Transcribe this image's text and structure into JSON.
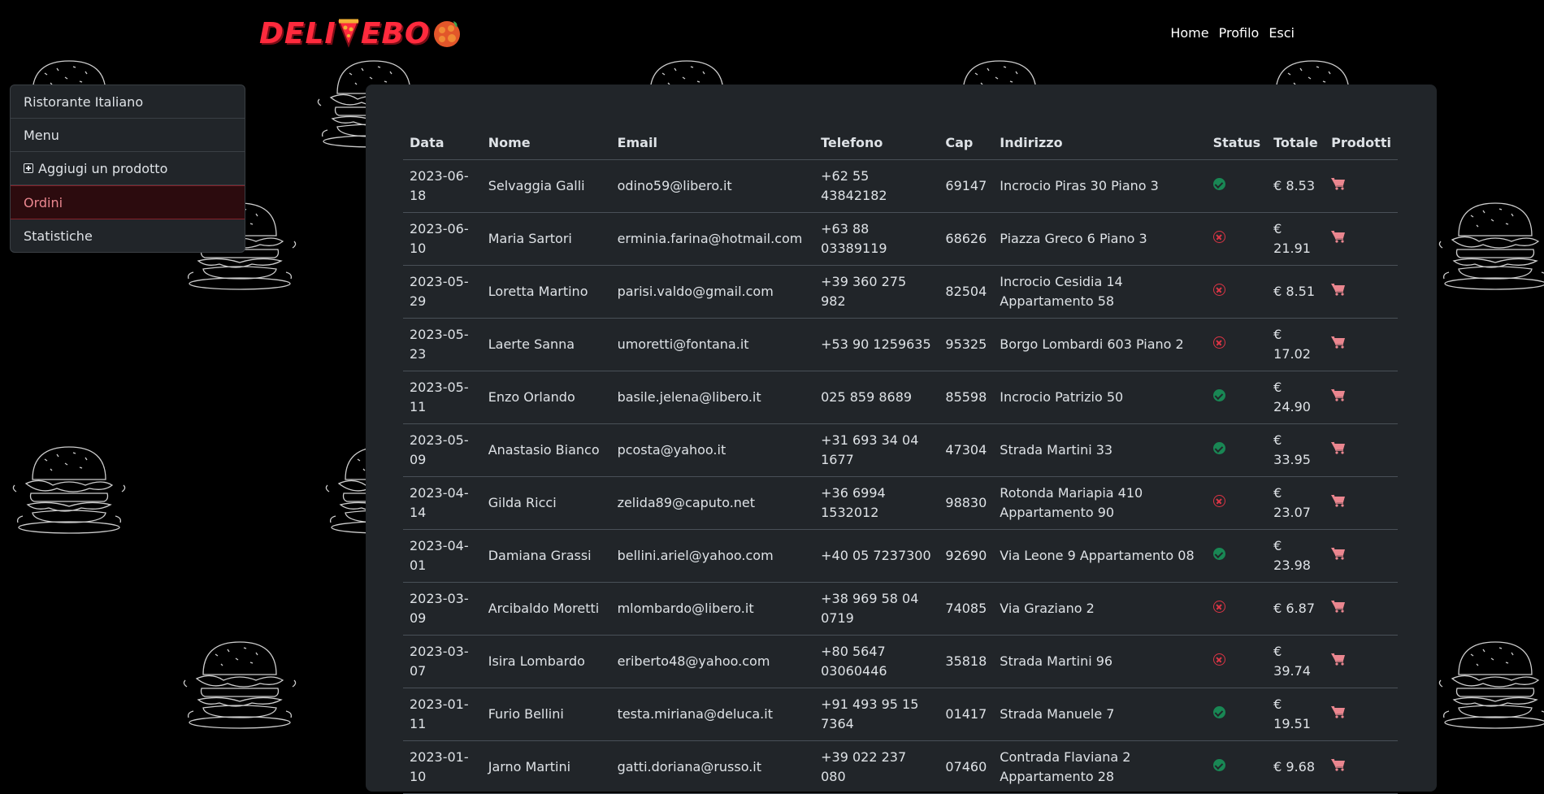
{
  "brand": {
    "logo_text": "DELIVEBOO",
    "logo_left": "DELI",
    "logo_right": "EBO"
  },
  "nav": {
    "home": "Home",
    "profile": "Profilo",
    "logout": "Esci"
  },
  "sidebar": {
    "items": [
      {
        "label": "Ristorante Italiano",
        "active": false
      },
      {
        "label": "Menu",
        "active": false
      },
      {
        "label": "Aggiugi un prodotto",
        "active": false,
        "icon": "plus-square-icon"
      },
      {
        "label": "Ordini",
        "active": true
      },
      {
        "label": "Statistiche",
        "active": false
      }
    ]
  },
  "orders": {
    "headers": {
      "date": "Data",
      "name": "Nome",
      "email": "Email",
      "phone": "Telefono",
      "cap": "Cap",
      "address": "Indirizzo",
      "status": "Status",
      "total": "Totale",
      "products": "Prodotti"
    },
    "rows": [
      {
        "date": "2023-06-18",
        "name": "Selvaggia Galli",
        "email": "odino59@libero.it",
        "phone": "+62 55 43842182",
        "cap": "69147",
        "address": "Incrocio Piras 30 Piano 3",
        "status": "ok",
        "total": "€ 8.53"
      },
      {
        "date": "2023-06-10",
        "name": "Maria Sartori",
        "email": "erminia.farina@hotmail.com",
        "phone": "+63 88 03389119",
        "cap": "68626",
        "address": "Piazza Greco 6 Piano 3",
        "status": "failed",
        "total": "€ 21.91"
      },
      {
        "date": "2023-05-29",
        "name": "Loretta Martino",
        "email": "parisi.valdo@gmail.com",
        "phone": "+39 360 275 982",
        "cap": "82504",
        "address": "Incrocio Cesidia 14 Appartamento 58",
        "status": "failed",
        "total": "€ 8.51"
      },
      {
        "date": "2023-05-23",
        "name": "Laerte Sanna",
        "email": "umoretti@fontana.it",
        "phone": "+53 90 1259635",
        "cap": "95325",
        "address": "Borgo Lombardi 603 Piano 2",
        "status": "failed",
        "total": "€ 17.02"
      },
      {
        "date": "2023-05-11",
        "name": "Enzo Orlando",
        "email": "basile.jelena@libero.it",
        "phone": "025 859 8689",
        "cap": "85598",
        "address": "Incrocio Patrizio 50",
        "status": "ok",
        "total": "€ 24.90"
      },
      {
        "date": "2023-05-09",
        "name": "Anastasio Bianco",
        "email": "pcosta@yahoo.it",
        "phone": "+31 693 34 04 1677",
        "cap": "47304",
        "address": "Strada Martini 33",
        "status": "ok",
        "total": "€ 33.95"
      },
      {
        "date": "2023-04-14",
        "name": "Gilda Ricci",
        "email": "zelida89@caputo.net",
        "phone": "+36 6994 1532012",
        "cap": "98830",
        "address": "Rotonda Mariapia 410 Appartamento 90",
        "status": "failed",
        "total": "€ 23.07"
      },
      {
        "date": "2023-04-01",
        "name": "Damiana Grassi",
        "email": "bellini.ariel@yahoo.com",
        "phone": "+40 05 7237300",
        "cap": "92690",
        "address": "Via Leone 9 Appartamento 08",
        "status": "ok",
        "total": "€ 23.98"
      },
      {
        "date": "2023-03-09",
        "name": "Arcibaldo Moretti",
        "email": "mlombardo@libero.it",
        "phone": "+38 969 58 04 0719",
        "cap": "74085",
        "address": "Via Graziano 2",
        "status": "failed",
        "total": "€ 6.87"
      },
      {
        "date": "2023-03-07",
        "name": "Isira Lombardo",
        "email": "eriberto48@yahoo.com",
        "phone": "+80 5647 03060446",
        "cap": "35818",
        "address": "Strada Martini 96",
        "status": "failed",
        "total": "€ 39.74"
      },
      {
        "date": "2023-01-11",
        "name": "Furio Bellini",
        "email": "testa.miriana@deluca.it",
        "phone": "+91 493 95 15 7364",
        "cap": "01417",
        "address": "Strada Manuele 7",
        "status": "ok",
        "total": "€ 19.51"
      },
      {
        "date": "2023-01-10",
        "name": "Jarno Martini",
        "email": "gatti.doriana@russo.it",
        "phone": "+39 022 237 080",
        "cap": "07460",
        "address": "Contrada Flaviana 2 Appartamento 28",
        "status": "ok",
        "total": "€ 9.68"
      }
    ]
  },
  "colors": {
    "ok": "#198754",
    "failed": "#dc3545",
    "cart": "#ea868f",
    "brand": "#ff2a3d",
    "active_bg": "#2c0b0e"
  }
}
